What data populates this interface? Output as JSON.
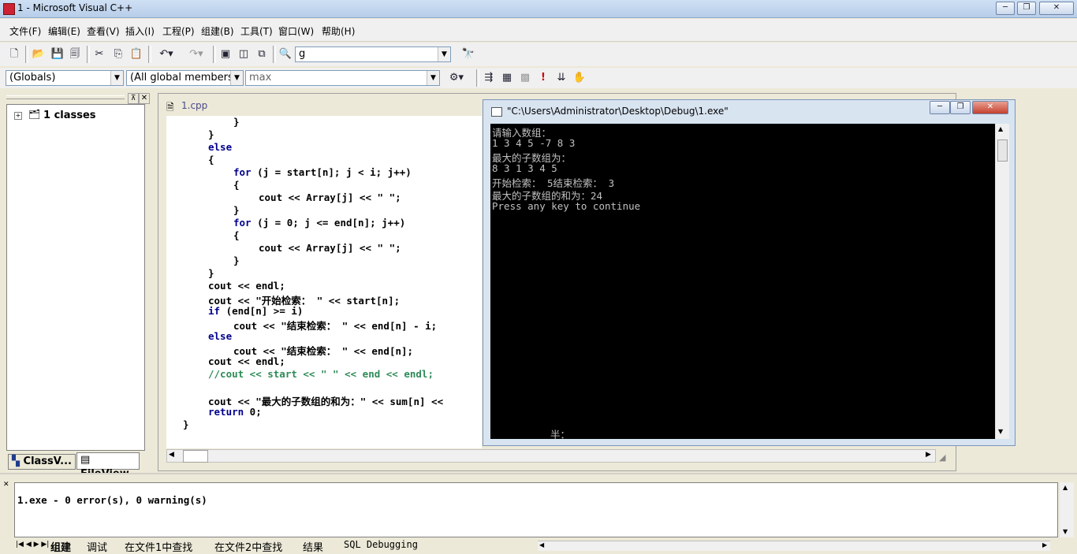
{
  "window": {
    "title": "1 - Microsoft Visual C++",
    "minimize": "─",
    "maximize": "❐",
    "close": "✕"
  },
  "menu": [
    "文件(F)",
    "编辑(E)",
    "查看(V)",
    "插入(I)",
    "工程(P)",
    "组建(B)",
    "工具(T)",
    "窗口(W)",
    "帮助(H)"
  ],
  "toolbar": {
    "find_combo_value": "g"
  },
  "wizardbar": {
    "scope": "(Globals)",
    "members": "(All global members",
    "function": "max"
  },
  "workspace": {
    "tree_root": "1 classes",
    "tab_classview": "ClassV...",
    "tab_fileview": "FileView"
  },
  "editor": {
    "tab_label": "1.cpp",
    "lines": [
      {
        "indent": 2,
        "text": "}",
        "kind": "normal"
      },
      {
        "indent": 1,
        "text": "}",
        "kind": "normal"
      },
      {
        "indent": 1,
        "text": "else",
        "kind": "keyword"
      },
      {
        "indent": 1,
        "text": "{",
        "kind": "normal"
      },
      {
        "indent": 2,
        "text": "for (j = start[n]; j < i; j++)",
        "kind": "for"
      },
      {
        "indent": 2,
        "text": "{",
        "kind": "normal"
      },
      {
        "indent": 3,
        "text": "cout << Array[j] << \" \";",
        "kind": "normal"
      },
      {
        "indent": 2,
        "text": "}",
        "kind": "normal"
      },
      {
        "indent": 2,
        "text": "for (j = 0; j <= end[n]; j++)",
        "kind": "for"
      },
      {
        "indent": 2,
        "text": "{",
        "kind": "normal"
      },
      {
        "indent": 3,
        "text": "cout << Array[j] << \" \";",
        "kind": "normal"
      },
      {
        "indent": 2,
        "text": "}",
        "kind": "normal"
      },
      {
        "indent": 1,
        "text": "}",
        "kind": "normal"
      },
      {
        "indent": 1,
        "text": "cout << endl;",
        "kind": "normal"
      },
      {
        "indent": 1,
        "text": "cout << \"开始检索： \" << start[n];",
        "kind": "normal"
      },
      {
        "indent": 1,
        "text": "if (end[n] >= i)",
        "kind": "if"
      },
      {
        "indent": 2,
        "text": "cout << \"结束检索： \" << end[n] - i;",
        "kind": "normal"
      },
      {
        "indent": 1,
        "text": "else",
        "kind": "keyword"
      },
      {
        "indent": 2,
        "text": "cout << \"结束检索： \" << end[n];",
        "kind": "normal"
      },
      {
        "indent": 1,
        "text": "cout << endl;",
        "kind": "normal"
      },
      {
        "indent": 1,
        "text": "//cout << start << \" \" << end << endl;",
        "kind": "comment"
      },
      {
        "indent": 1,
        "text": "",
        "kind": "normal"
      },
      {
        "indent": 1,
        "text": "cout << \"最大的子数组的和为：\" << sum[n] <<",
        "kind": "normal"
      },
      {
        "indent": 1,
        "text": "return 0;",
        "kind": "return"
      },
      {
        "indent": 0,
        "text": "}",
        "kind": "normal"
      }
    ]
  },
  "console": {
    "title": "\"C:\\Users\\Administrator\\Desktop\\Debug\\1.exe\"",
    "lines": [
      "请输入数组：",
      "1 3 4 5 -7 8 3",
      "最大的子数组为：",
      "8 3 1 3 4 5",
      "开始检索： 5结束检索： 3",
      "最大的子数组的和为：24",
      "Press any key to continue"
    ],
    "ime_indicator": "半："
  },
  "output": {
    "message": "1.exe - 0 error(s), 0 warning(s)",
    "tabs": [
      "组建",
      "调试",
      "在文件1中查找",
      "在文件2中查找",
      "结果",
      "SQL Debugging"
    ]
  }
}
